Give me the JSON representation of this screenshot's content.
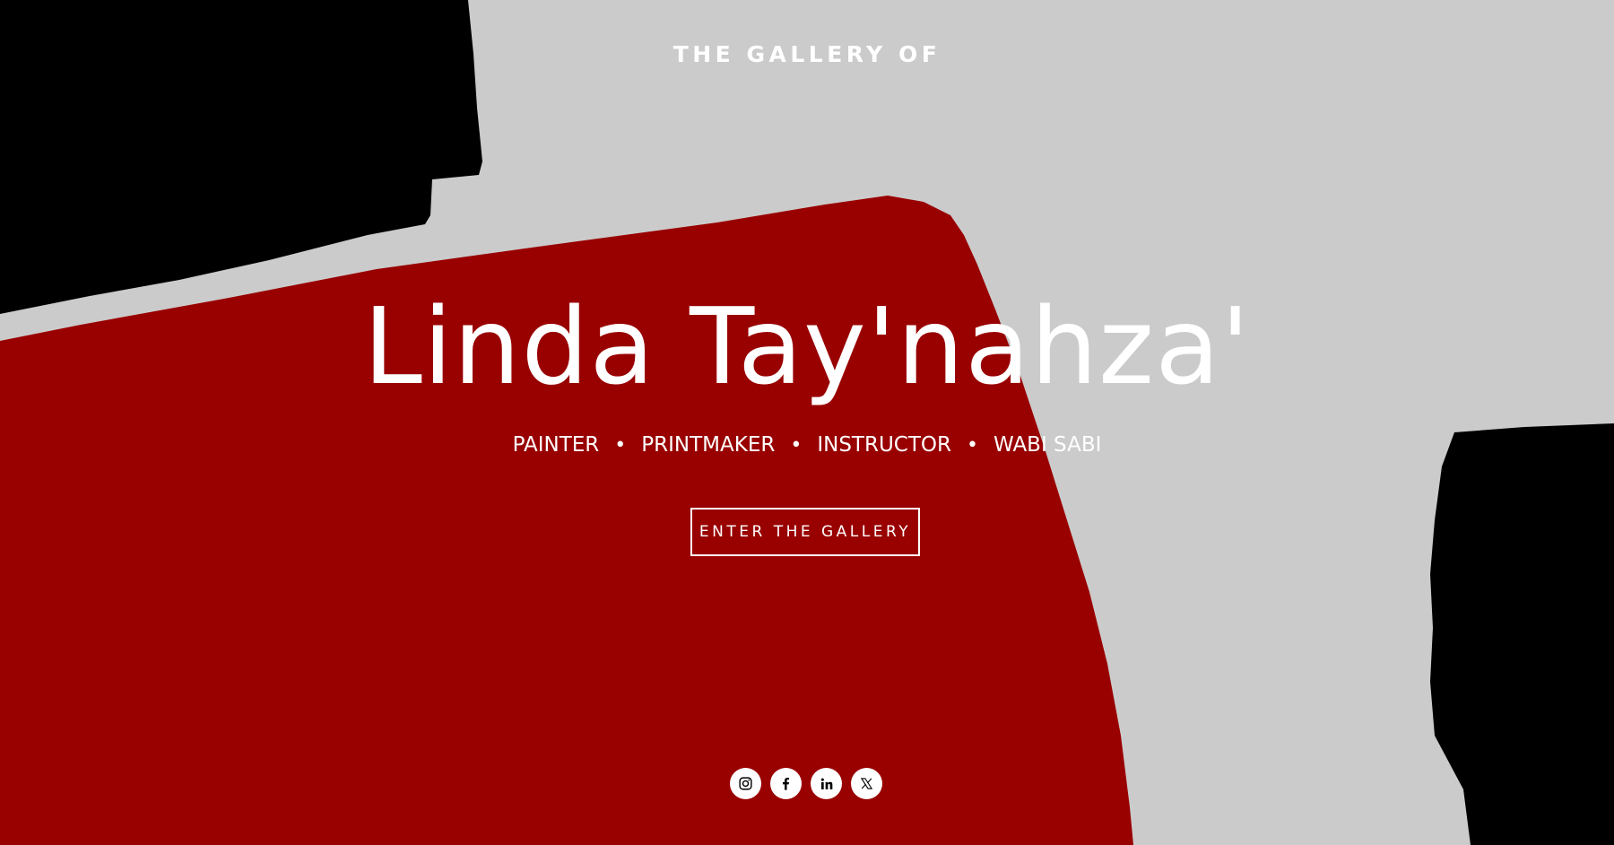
{
  "hero": {
    "eyebrow": "THE GALLERY OF",
    "title": "Linda Tay'nahza'",
    "roles": [
      "PAINTER",
      "PRINTMAKER",
      "INSTRUCTOR",
      "WABI SABI"
    ],
    "role_separator": "•",
    "cta_label": "ENTER THE GALLERY"
  },
  "social_links": [
    {
      "name": "instagram",
      "icon": "instagram-icon"
    },
    {
      "name": "facebook",
      "icon": "facebook-icon"
    },
    {
      "name": "linkedin",
      "icon": "linkedin-icon"
    },
    {
      "name": "x",
      "icon": "x-icon"
    }
  ],
  "colors": {
    "background_gray": "#cbcbcb",
    "accent_red": "#990000",
    "black": "#000000",
    "text": "#ffffff"
  }
}
